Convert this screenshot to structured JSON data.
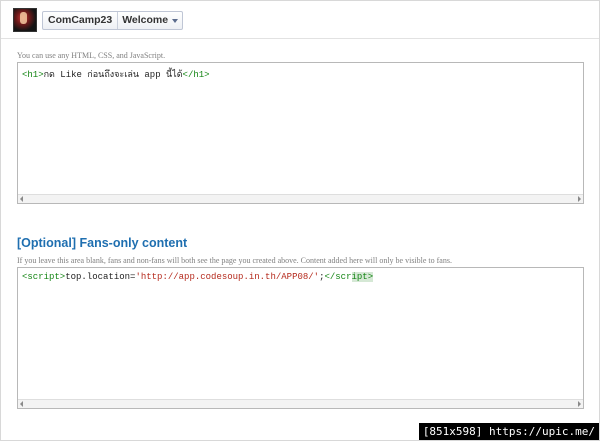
{
  "header": {
    "page_name": "ComCamp23",
    "tab_label": "Welcome",
    "tab_dropdown_icon": "chevron-down-icon",
    "avatar_icon": "page-avatar"
  },
  "editor_main": {
    "hint": "You can use any HTML, CSS, and JavaScript.",
    "code": {
      "open_tag": "<h1>",
      "text": "กด Like ก่อนถึงจะเล่น app นี้ได้",
      "close_tag": "</h1>"
    }
  },
  "fans_only": {
    "title": "[Optional] Fans-only content",
    "hint": "If you leave this area blank, fans and non-fans will both see the page you created above. Content added here will only be visible to fans.",
    "code": {
      "open_tag": "<script>",
      "js_prefix": "top.location=",
      "string": "'http://app.codesoup.in.th/APP08/'",
      "js_suffix": ";",
      "close_tag_a": "</scr",
      "close_tag_b": "ipt>"
    }
  },
  "watermark": {
    "text": "[851x598] https://upic.me/"
  }
}
